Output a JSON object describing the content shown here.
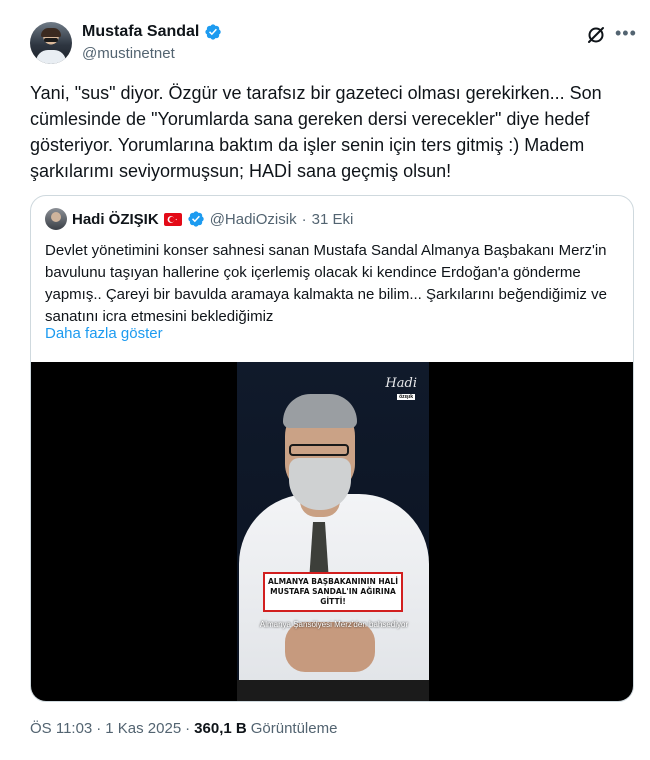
{
  "author": {
    "display_name": "Mustafa Sandal",
    "handle": "@mustinetnet"
  },
  "tweet": {
    "text": "Yani, \"sus\" diyor. Özgür ve tarafsız bir gazeteci olması gerekirken... Son cümlesinde de \"Yorumlarda sana gereken dersi verecekler\" diye hedef gösteriyor. Yorumlarına baktım da işler senin için ters gitmiş :) Madem şarkılarımı seviyormuşsun; HADİ sana geçmiş olsun!"
  },
  "quote": {
    "display_name": "Hadi ÖZIŞIK",
    "handle": "@HadiOzisik",
    "separator": "·",
    "date": "31 Eki",
    "text": "Devlet yönetimini konser sahnesi sanan Mustafa Sandal Almanya Başbakanı Merz'in bavulunu taşıyan hallerine çok içerlemiş olacak ki kendince Erdoğan'a gönderme yapmış.. Çareyi bir bavulda aramaya kalmakta ne bilim... Şarkılarını beğendiğimiz ve sanatını icra etmesini beklediğimiz",
    "show_more": "Daha fazla göster",
    "video": {
      "watermark": "Hadi",
      "watermark_sub": "özışık",
      "banner_line1": "ALMANYA BAŞBAKANININ HALİ",
      "banner_line2": "MUSTAFA SANDAL'IN AĞIRINA GİTTİ!",
      "caption": "Almanya Şansölyesi Merz'den bahsediyor"
    }
  },
  "footer": {
    "time": "ÖS 11:03",
    "dot1": "·",
    "date": "1 Kas 2025",
    "dot2": "·",
    "views_count": "360,1 B",
    "views_label": "Görüntüleme"
  },
  "colors": {
    "verified": "#1d9bf0",
    "link": "#1d9bf0",
    "secondary_text": "#536471",
    "flag_red": "#e30a17"
  },
  "icons": [
    "verified-badge-icon",
    "grok-icon",
    "more-icon",
    "turkey-flag-icon"
  ]
}
